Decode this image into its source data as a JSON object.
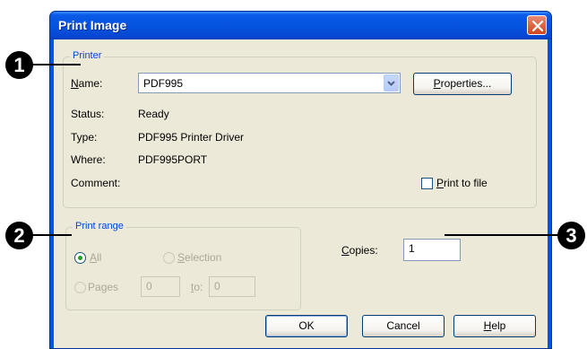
{
  "dialog": {
    "title": "Print Image"
  },
  "printer_group": {
    "legend": "Printer",
    "name_label": "Name:",
    "name_value": "PDF995",
    "properties_button": "Properties...",
    "status_label": "Status:",
    "status_value": "Ready",
    "type_label": "Type:",
    "type_value": "PDF995 Printer Driver",
    "where_label": "Where:",
    "where_value": "PDF995PORT",
    "comment_label": "Comment:",
    "comment_value": "",
    "print_to_file_label": "Print to file",
    "print_to_file_checked": false
  },
  "print_range_group": {
    "legend": "Print range",
    "all_label": "All",
    "all_selected": true,
    "selection_label": "Selection",
    "pages_label": "Pages",
    "from_value": "0",
    "to_label": "to:",
    "to_value": "0"
  },
  "copies": {
    "label": "Copies:",
    "value": "1"
  },
  "buttons": {
    "ok": "OK",
    "cancel": "Cancel",
    "help": "Help"
  },
  "callouts": {
    "one": "1",
    "two": "2",
    "three": "3"
  },
  "colors": {
    "titlebar": "#0553df",
    "client_bg": "#ece9d8",
    "legend_text": "#0046d5",
    "close_button": "#d2441d",
    "radio_dot": "#21a121"
  },
  "icons": {
    "close": "close-x-icon",
    "dropdown": "chevron-down-icon"
  }
}
